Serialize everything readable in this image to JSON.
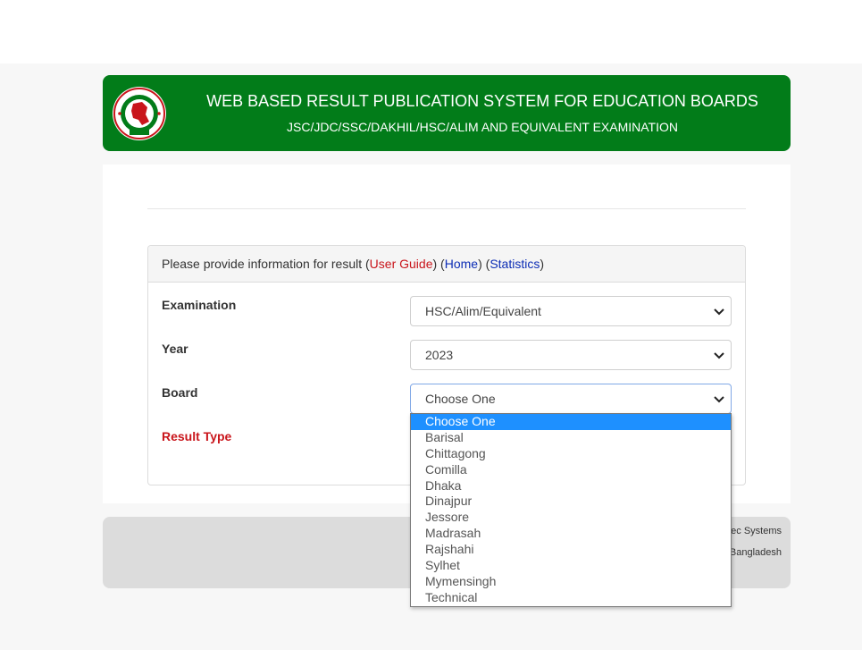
{
  "header": {
    "title": "WEB BASED RESULT PUBLICATION SYSTEM FOR EDUCATION BOARDS",
    "subtitle": "JSC/JDC/SSC/DAKHIL/HSC/ALIM AND EQUIVALENT EXAMINATION",
    "logo_icon": "bangladesh-government-seal-icon"
  },
  "panel": {
    "intro": "Please provide information for result",
    "user_guide": "User Guide",
    "home": "Home",
    "statistics": "Statistics",
    "open_paren": "(",
    "close_paren": ")"
  },
  "form": {
    "examination_label": "Examination",
    "examination_value": "HSC/Alim/Equivalent",
    "year_label": "Year",
    "year_value": "2023",
    "board_label": "Board",
    "board_value": "Choose One",
    "result_type_label": "Result Type"
  },
  "board_options": [
    "Choose One",
    "Barisal",
    "Chittagong",
    "Comilla",
    "Dhaka",
    "Dinajpur",
    "Jessore",
    "Madrasah",
    "Rajshahi",
    "Sylhet",
    "Mymensingh",
    "Technical"
  ],
  "footer": {
    "line1": "ec Systems",
    "line2": "Bangladesh"
  },
  "colors": {
    "header_green": "#027c19",
    "link_red": "#c9151b",
    "link_blue": "#0c2db5",
    "selected_option": "#1e90ff"
  }
}
